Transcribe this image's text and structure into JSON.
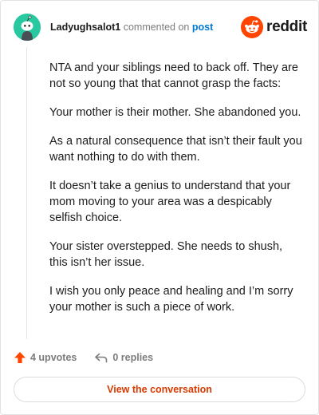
{
  "header": {
    "username": "Ladyughsalot1",
    "commented_text": "commented on",
    "post_link": "post",
    "brand_wordmark": "reddit"
  },
  "comment": {
    "paragraphs": [
      "NTA and your siblings need to back off. They are not so young that that cannot grasp the facts:",
      "Your mother is their mother. She abandoned you.",
      "As a natural consequence that isn’t their fault you want nothing to do with them.",
      "It doesn’t take a genius to understand that your mom moving to your area was a despicably selfish choice.",
      "Your sister overstepped. She needs to shush, this isn’t her issue.",
      "I wish you only peace and healing and I’m sorry your mother is such a piece of work."
    ]
  },
  "actions": {
    "upvotes": "4 upvotes",
    "replies": "0 replies"
  },
  "cta": {
    "label": "View the conversation"
  },
  "colors": {
    "brand": "#ff4500",
    "link": "#0079d3",
    "cta_text": "#d93a00",
    "avatar_bg": "#28c8a0"
  }
}
